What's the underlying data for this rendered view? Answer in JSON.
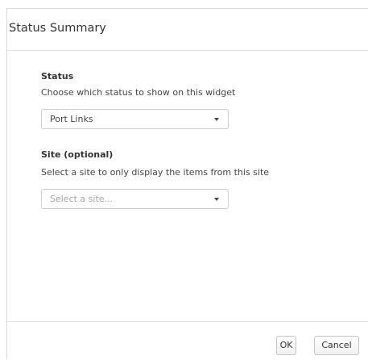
{
  "dialog": {
    "title": "Status Summary"
  },
  "status": {
    "label": "Status",
    "help": "Choose which status to show on this widget",
    "selected": "Port Links"
  },
  "site": {
    "label": "Site (optional)",
    "help": "Select a site to only display the items from this site",
    "placeholder": "Select a site..."
  },
  "footer": {
    "ok_label": "OK",
    "cancel_label": "Cancel"
  },
  "icons": {
    "dropdown": "chevron-down-icon"
  }
}
